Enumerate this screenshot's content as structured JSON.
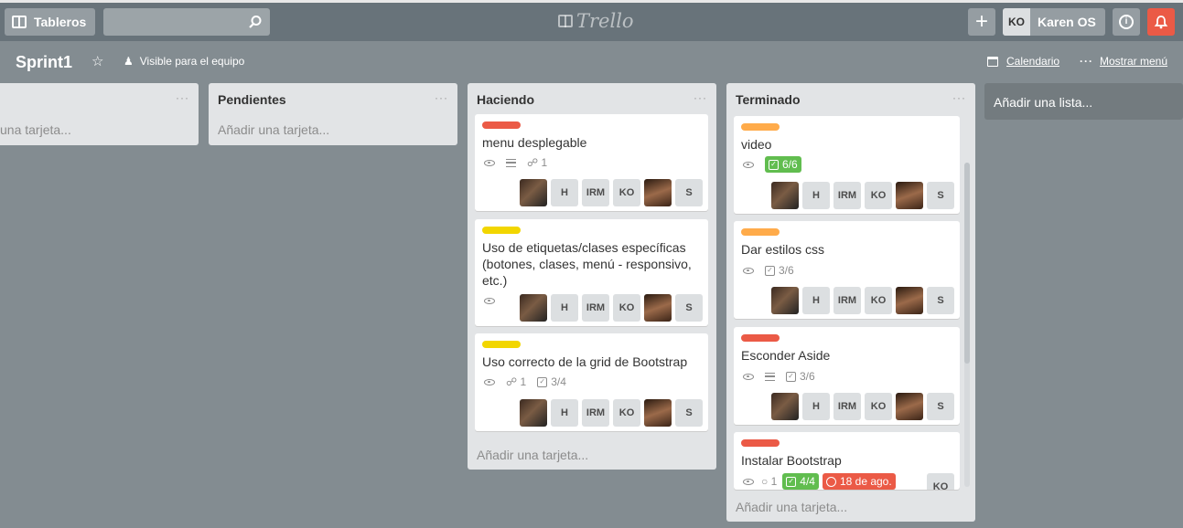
{
  "header": {
    "boards_label": "Tableros",
    "logo_text": "Trello",
    "add_label": "+",
    "user_initials": "KO",
    "user_name": "Karen OS",
    "info_label": "i"
  },
  "board": {
    "title": "Sprint1",
    "visibility": "Visible para el equipo",
    "calendar_label": "Calendario",
    "menu_label": "Mostrar menú",
    "add_list": "Añadir una lista..."
  },
  "lists": [
    {
      "name": "",
      "add_card": "una tarjeta..."
    },
    {
      "name": "Pendientes",
      "add_card": "Añadir una tarjeta..."
    },
    {
      "name": "Haciendo",
      "add_card": "Añadir una tarjeta...",
      "cards": [
        {
          "title": "menu desplegable",
          "attachments": "1"
        },
        {
          "title": "Uso de etiquetas/clases específicas (botones, clases, menú - responsivo, etc.)"
        },
        {
          "title": "Uso correcto de la grid de Bootstrap",
          "attachments": "1",
          "checklist": "3/4"
        }
      ]
    },
    {
      "name": "Terminado",
      "add_card": "Añadir una tarjeta...",
      "cards": [
        {
          "title": "video",
          "checklist": "6/6"
        },
        {
          "title": "Dar estilos css",
          "checklist": "3/6"
        },
        {
          "title": "Esconder Aside",
          "checklist": "3/6"
        },
        {
          "title": "Instalar Bootstrap",
          "comments": "1",
          "checklist": "4/4",
          "due": "18 de ago."
        }
      ]
    }
  ],
  "members": [
    "H",
    "IRM",
    "KO",
    "S"
  ],
  "member_solo": "KO",
  "colors": {
    "red": "#eb5a46",
    "yellow": "#f2d600",
    "orange": "#ffab4a",
    "green": "#61bd4f"
  }
}
